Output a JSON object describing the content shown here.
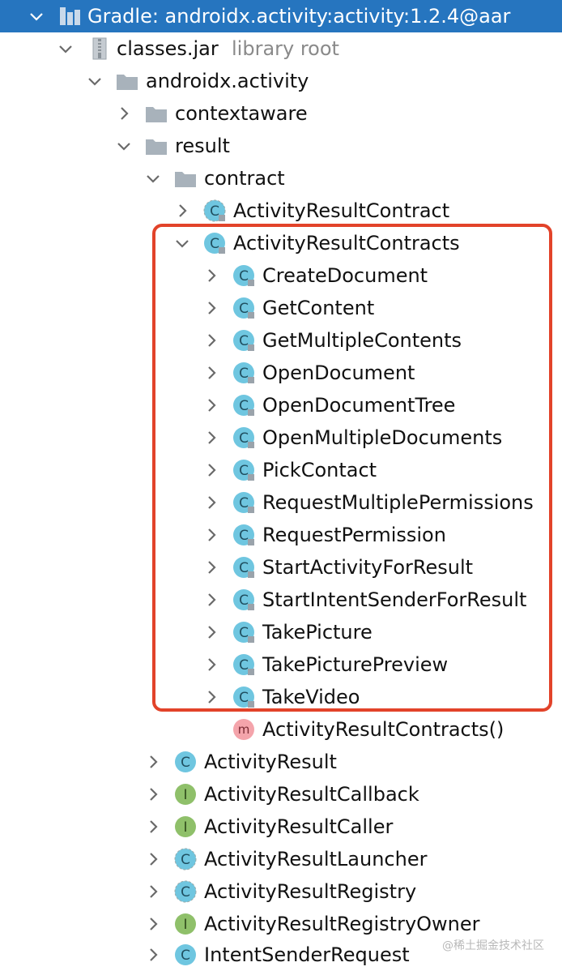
{
  "tree": {
    "root": {
      "label": "Gradle: androidx.activity:activity:1.2.4@aar"
    },
    "jar": {
      "label": "classes.jar",
      "hint": "library root"
    },
    "package": {
      "label": "androidx.activity"
    },
    "pkg_contextaware": {
      "label": "contextaware"
    },
    "pkg_result": {
      "label": "result"
    },
    "pkg_contract": {
      "label": "contract"
    },
    "class_activity_result_contract": {
      "label": "ActivityResultContract"
    },
    "class_activity_result_contracts": {
      "label": "ActivityResultContracts",
      "nested": [
        {
          "label": "CreateDocument",
          "icon": "class-icon"
        },
        {
          "label": "GetContent",
          "icon": "class-icon"
        },
        {
          "label": "GetMultipleContents",
          "icon": "class-icon"
        },
        {
          "label": "OpenDocument",
          "icon": "class-icon"
        },
        {
          "label": "OpenDocumentTree",
          "icon": "class-icon"
        },
        {
          "label": "OpenMultipleDocuments",
          "icon": "class-icon"
        },
        {
          "label": "PickContact",
          "icon": "class-icon"
        },
        {
          "label": "RequestMultiplePermissions",
          "icon": "class-icon"
        },
        {
          "label": "RequestPermission",
          "icon": "class-icon"
        },
        {
          "label": "StartActivityForResult",
          "icon": "class-icon"
        },
        {
          "label": "StartIntentSenderForResult",
          "icon": "class-icon"
        },
        {
          "label": "TakePicture",
          "icon": "class-icon"
        },
        {
          "label": "TakePicturePreview",
          "icon": "class-icon"
        },
        {
          "label": "TakeVideo",
          "icon": "class-icon"
        }
      ],
      "constructor": {
        "label": "ActivityResultContracts()",
        "icon": "method-icon"
      }
    },
    "result_items": [
      {
        "label": "ActivityResult",
        "icon": "class-icon"
      },
      {
        "label": "ActivityResultCallback",
        "icon": "interface-icon"
      },
      {
        "label": "ActivityResultCaller",
        "icon": "interface-icon"
      },
      {
        "label": "ActivityResultLauncher",
        "icon": "abstract-class-icon"
      },
      {
        "label": "ActivityResultRegistry",
        "icon": "abstract-class-icon"
      },
      {
        "label": "ActivityResultRegistryOwner",
        "icon": "interface-icon"
      },
      {
        "label": "IntentSenderRequest",
        "icon": "class-icon"
      }
    ]
  },
  "watermark": "@稀土掘金技术社区",
  "colors": {
    "selection": "#2675bf",
    "highlight_border": "#e2432a",
    "class_icon": "#6fc6e0",
    "interface_icon": "#8fc06a",
    "method_icon": "#f4a4ab"
  }
}
